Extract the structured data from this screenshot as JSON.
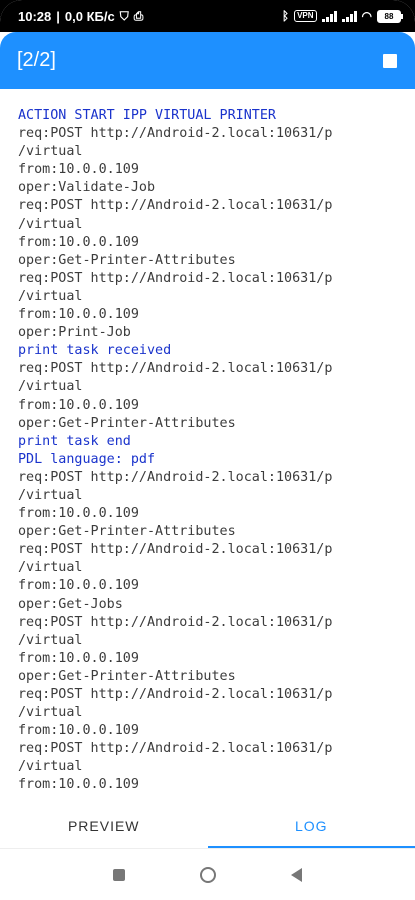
{
  "status_bar": {
    "time": "10:28",
    "speed": "0,0 КБ/с",
    "vpn_label": "VPN",
    "battery_level": "88"
  },
  "app_bar": {
    "title": "[2/2]"
  },
  "log": [
    {
      "text": "ACTION START IPP VIRTUAL PRINTER",
      "kind": "info"
    },
    {
      "text": "req:POST http://Android-2.local:10631/p",
      "kind": "plain"
    },
    {
      "text": "/virtual",
      "kind": "plain"
    },
    {
      "text": "from:10.0.0.109",
      "kind": "plain"
    },
    {
      "text": "oper:Validate-Job",
      "kind": "plain"
    },
    {
      "text": "req:POST http://Android-2.local:10631/p",
      "kind": "plain"
    },
    {
      "text": "/virtual",
      "kind": "plain"
    },
    {
      "text": "from:10.0.0.109",
      "kind": "plain"
    },
    {
      "text": "oper:Get-Printer-Attributes",
      "kind": "plain"
    },
    {
      "text": "req:POST http://Android-2.local:10631/p",
      "kind": "plain"
    },
    {
      "text": "/virtual",
      "kind": "plain"
    },
    {
      "text": "from:10.0.0.109",
      "kind": "plain"
    },
    {
      "text": "oper:Print-Job",
      "kind": "plain"
    },
    {
      "text": "print task received",
      "kind": "info"
    },
    {
      "text": "req:POST http://Android-2.local:10631/p",
      "kind": "plain"
    },
    {
      "text": "/virtual",
      "kind": "plain"
    },
    {
      "text": "from:10.0.0.109",
      "kind": "plain"
    },
    {
      "text": "oper:Get-Printer-Attributes",
      "kind": "plain"
    },
    {
      "text": "print task end",
      "kind": "info"
    },
    {
      "text": "PDL language: pdf",
      "kind": "info"
    },
    {
      "text": "req:POST http://Android-2.local:10631/p",
      "kind": "plain"
    },
    {
      "text": "/virtual",
      "kind": "plain"
    },
    {
      "text": "from:10.0.0.109",
      "kind": "plain"
    },
    {
      "text": "oper:Get-Printer-Attributes",
      "kind": "plain"
    },
    {
      "text": "req:POST http://Android-2.local:10631/p",
      "kind": "plain"
    },
    {
      "text": "/virtual",
      "kind": "plain"
    },
    {
      "text": "from:10.0.0.109",
      "kind": "plain"
    },
    {
      "text": "oper:Get-Jobs",
      "kind": "plain"
    },
    {
      "text": "req:POST http://Android-2.local:10631/p",
      "kind": "plain"
    },
    {
      "text": "/virtual",
      "kind": "plain"
    },
    {
      "text": "from:10.0.0.109",
      "kind": "plain"
    },
    {
      "text": "oper:Get-Printer-Attributes",
      "kind": "plain"
    },
    {
      "text": "req:POST http://Android-2.local:10631/p",
      "kind": "plain"
    },
    {
      "text": "/virtual",
      "kind": "plain"
    },
    {
      "text": "from:10.0.0.109",
      "kind": "plain"
    },
    {
      "text": "req:POST http://Android-2.local:10631/p",
      "kind": "plain"
    },
    {
      "text": "/virtual",
      "kind": "plain"
    },
    {
      "text": "from:10.0.0.109",
      "kind": "plain"
    }
  ],
  "tabs": [
    {
      "label": "PREVIEW",
      "active": false
    },
    {
      "label": "LOG",
      "active": true
    }
  ],
  "colors": {
    "accent": "#1e90ff",
    "info_text": "#1a33cc",
    "log_text": "#3c3c3c"
  }
}
